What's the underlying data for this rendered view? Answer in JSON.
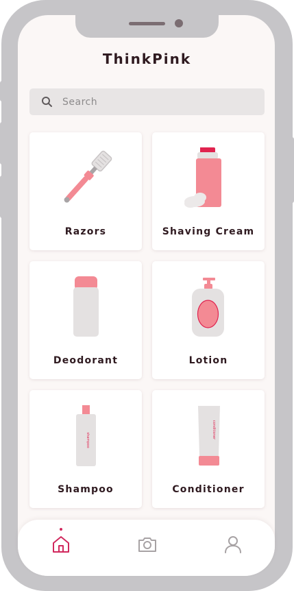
{
  "app": {
    "title": "ThinkPink"
  },
  "search": {
    "placeholder": "Search",
    "icon": "search-icon"
  },
  "categories": [
    {
      "label": "Razors",
      "icon": "razor-icon"
    },
    {
      "label": "Shaving Cream",
      "icon": "shaving-cream-icon"
    },
    {
      "label": "Deodorant",
      "icon": "deodorant-icon"
    },
    {
      "label": "Lotion",
      "icon": "lotion-icon"
    },
    {
      "label": "Shampoo",
      "icon": "shampoo-icon",
      "bottle_text": "shampoo"
    },
    {
      "label": "Conditioner",
      "icon": "conditioner-icon",
      "bottle_text": "conditioner"
    }
  ],
  "nav": {
    "items": [
      {
        "name": "home",
        "icon": "home-icon",
        "active": true
      },
      {
        "name": "camera",
        "icon": "camera-icon",
        "active": false
      },
      {
        "name": "profile",
        "icon": "user-icon",
        "active": false
      }
    ]
  },
  "colors": {
    "accent": "#d1285d",
    "pink": "#f38a94",
    "gray": "#e4e1e1",
    "text": "#2f1a20",
    "frame": "#c6c5c8"
  }
}
